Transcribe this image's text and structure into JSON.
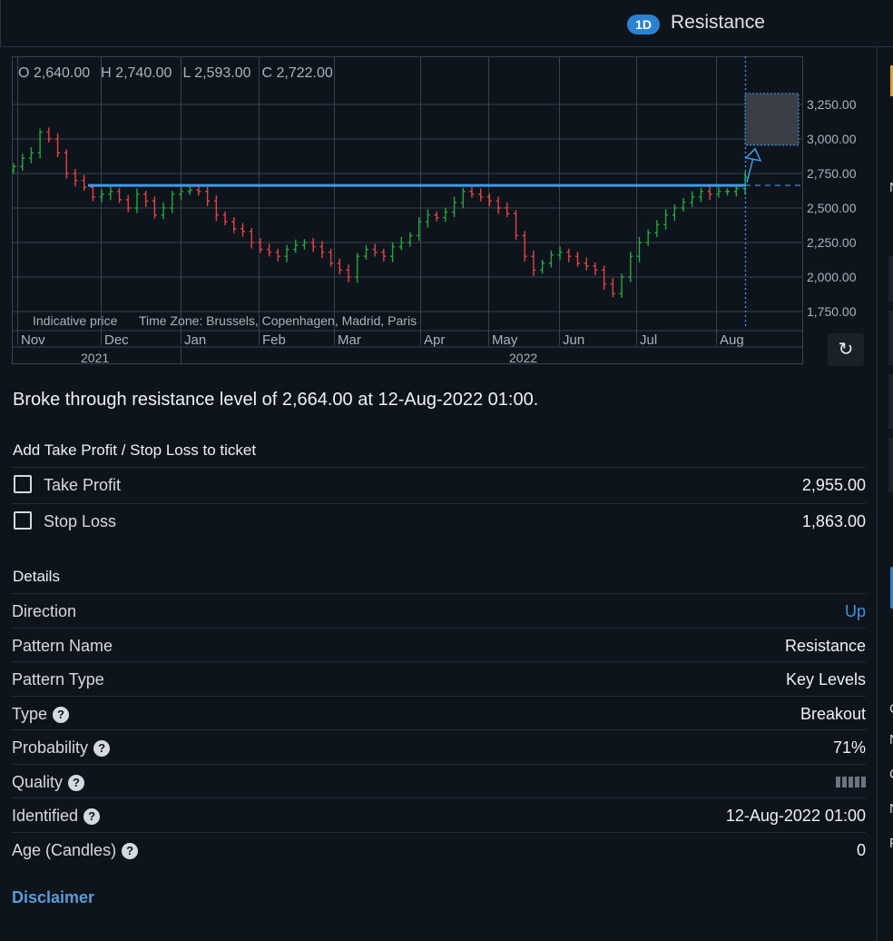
{
  "header": {
    "timeframe": "1D",
    "title": "Resistance"
  },
  "chart": {
    "ohlc": {
      "open": "O 2,640.00",
      "high": "H 2,740.00",
      "low": "L 2,593.00",
      "close": "C 2,722.00"
    },
    "indicative": "Indicative price",
    "timezone": "Time Zone: Brussels, Copenhagen, Madrid, Paris",
    "months": [
      "Nov",
      "Dec",
      "Jan",
      "Feb",
      "Mar",
      "Apr",
      "May",
      "Jun",
      "Jul",
      "Aug"
    ],
    "years": [
      "2021",
      "2022"
    ],
    "y_ticks": [
      "3,250.00",
      "3,000.00",
      "2,750.00",
      "2,500.00",
      "2,250.00",
      "2,000.00",
      "1,750.00"
    ],
    "colors": {
      "up": "#22a83a",
      "down": "#e04545",
      "resistance": "#3d9be9",
      "grid": "#3a424d"
    }
  },
  "chart_data": {
    "type": "candlestick",
    "y_ticks": [
      3250,
      3000,
      2750,
      2500,
      2250,
      2000,
      1750
    ],
    "ylim": [
      1650,
      3400
    ],
    "resistance_level": 2664,
    "target_zone": [
      2955,
      3330
    ],
    "closes": [
      2800,
      2860,
      2900,
      3050,
      3000,
      2900,
      2750,
      2700,
      2650,
      2580,
      2600,
      2620,
      2560,
      2500,
      2600,
      2550,
      2450,
      2500,
      2600,
      2620,
      2630,
      2620,
      2550,
      2450,
      2400,
      2350,
      2330,
      2250,
      2200,
      2180,
      2150,
      2200,
      2230,
      2250,
      2220,
      2180,
      2100,
      2050,
      2000,
      2150,
      2200,
      2180,
      2150,
      2220,
      2250,
      2300,
      2400,
      2450,
      2430,
      2470,
      2540,
      2620,
      2600,
      2580,
      2550,
      2500,
      2460,
      2300,
      2150,
      2050,
      2100,
      2160,
      2180,
      2150,
      2100,
      2080,
      2050,
      1950,
      1880,
      2000,
      2150,
      2250,
      2320,
      2380,
      2450,
      2500,
      2540,
      2580,
      2620,
      2600,
      2620,
      2620,
      2640,
      2722
    ]
  },
  "headline": "Broke through resistance level of 2,664.00 at 12-Aug-2022 01:00.",
  "ticket": {
    "title": "Add Take Profit / Stop Loss to ticket",
    "take_profit_label": "Take Profit",
    "take_profit_value": "2,955.00",
    "stop_loss_label": "Stop Loss",
    "stop_loss_value": "1,863.00"
  },
  "details": {
    "title": "Details",
    "direction_label": "Direction",
    "direction_value": "Up",
    "pattern_name_label": "Pattern Name",
    "pattern_name_value": "Resistance",
    "pattern_type_label": "Pattern Type",
    "pattern_type_value": "Key Levels",
    "type_label": "Type",
    "type_value": "Breakout",
    "probability_label": "Probability",
    "probability_value": "71%",
    "quality_label": "Quality",
    "quality_level": 5,
    "identified_label": "Identified",
    "identified_value": "12-Aug-2022 01:00",
    "age_label": "Age (Candles)",
    "age_value": "0",
    "help_glyph": "?"
  },
  "disclaimer": "Disclaimer",
  "edge": {
    "letters": [
      "N",
      "C",
      "N",
      "C",
      "N",
      "F"
    ]
  }
}
